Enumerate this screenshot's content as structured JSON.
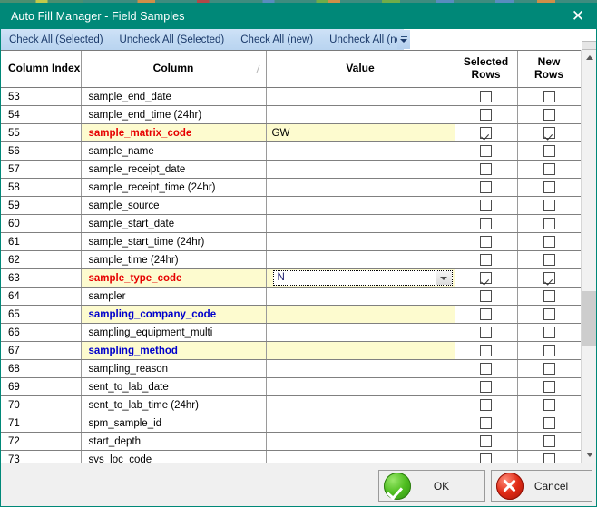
{
  "window": {
    "title": "Auto Fill Manager - Field Samples",
    "close_label": "✕",
    "titlebar_color": "#008878"
  },
  "toolbar": {
    "items": [
      {
        "label": "Check All (Selected)"
      },
      {
        "label": "Uncheck All (Selected)"
      },
      {
        "label": "Check All (new)"
      },
      {
        "label": "Uncheck All (new)"
      }
    ],
    "overflow_label": ""
  },
  "grid": {
    "headers": {
      "column_index": "Column Index",
      "column": "Column",
      "value": "Value",
      "selected_rows_line1": "Selected",
      "selected_rows_line2": "Rows",
      "new_rows_line1": "New",
      "new_rows_line2": "Rows"
    },
    "highlight_colors": {
      "row_background": "#fdfbcf",
      "required_text": "#e60000",
      "optional_text": "#0000cc"
    },
    "rows": [
      {
        "index": "53",
        "column": "sample_end_date",
        "value": "",
        "selected": false,
        "new": false,
        "highlight": false,
        "style": ""
      },
      {
        "index": "54",
        "column": "sample_end_time (24hr)",
        "value": "",
        "selected": false,
        "new": false,
        "highlight": false,
        "style": ""
      },
      {
        "index": "55",
        "column": "sample_matrix_code",
        "value": "GW",
        "selected": true,
        "new": true,
        "highlight": true,
        "style": "red"
      },
      {
        "index": "56",
        "column": "sample_name",
        "value": "",
        "selected": false,
        "new": false,
        "highlight": false,
        "style": ""
      },
      {
        "index": "57",
        "column": "sample_receipt_date",
        "value": "",
        "selected": false,
        "new": false,
        "highlight": false,
        "style": ""
      },
      {
        "index": "58",
        "column": "sample_receipt_time (24hr)",
        "value": "",
        "selected": false,
        "new": false,
        "highlight": false,
        "style": ""
      },
      {
        "index": "59",
        "column": "sample_source",
        "value": "",
        "selected": false,
        "new": false,
        "highlight": false,
        "style": ""
      },
      {
        "index": "60",
        "column": "sample_start_date",
        "value": "",
        "selected": false,
        "new": false,
        "highlight": false,
        "style": ""
      },
      {
        "index": "61",
        "column": "sample_start_time (24hr)",
        "value": "",
        "selected": false,
        "new": false,
        "highlight": false,
        "style": ""
      },
      {
        "index": "62",
        "column": "sample_time (24hr)",
        "value": "",
        "selected": false,
        "new": false,
        "highlight": false,
        "style": ""
      },
      {
        "index": "63",
        "column": "sample_type_code",
        "value": "N",
        "selected": true,
        "new": true,
        "highlight": true,
        "style": "red",
        "editing": true
      },
      {
        "index": "64",
        "column": "sampler",
        "value": "",
        "selected": false,
        "new": false,
        "highlight": false,
        "style": ""
      },
      {
        "index": "65",
        "column": "sampling_company_code",
        "value": "",
        "selected": false,
        "new": false,
        "highlight": true,
        "style": "blue"
      },
      {
        "index": "66",
        "column": "sampling_equipment_multi",
        "value": "",
        "selected": false,
        "new": false,
        "highlight": false,
        "style": ""
      },
      {
        "index": "67",
        "column": "sampling_method",
        "value": "",
        "selected": false,
        "new": false,
        "highlight": true,
        "style": "blue"
      },
      {
        "index": "68",
        "column": "sampling_reason",
        "value": "",
        "selected": false,
        "new": false,
        "highlight": false,
        "style": ""
      },
      {
        "index": "69",
        "column": "sent_to_lab_date",
        "value": "",
        "selected": false,
        "new": false,
        "highlight": false,
        "style": ""
      },
      {
        "index": "70",
        "column": "sent_to_lab_time (24hr)",
        "value": "",
        "selected": false,
        "new": false,
        "highlight": false,
        "style": ""
      },
      {
        "index": "71",
        "column": "spm_sample_id",
        "value": "",
        "selected": false,
        "new": false,
        "highlight": false,
        "style": ""
      },
      {
        "index": "72",
        "column": "start_depth",
        "value": "",
        "selected": false,
        "new": false,
        "highlight": false,
        "style": ""
      },
      {
        "index": "73",
        "column": "sys_loc_code",
        "value": "",
        "selected": false,
        "new": false,
        "highlight": false,
        "style": ""
      }
    ]
  },
  "footer": {
    "ok_label": "OK",
    "cancel_label": "Cancel"
  }
}
